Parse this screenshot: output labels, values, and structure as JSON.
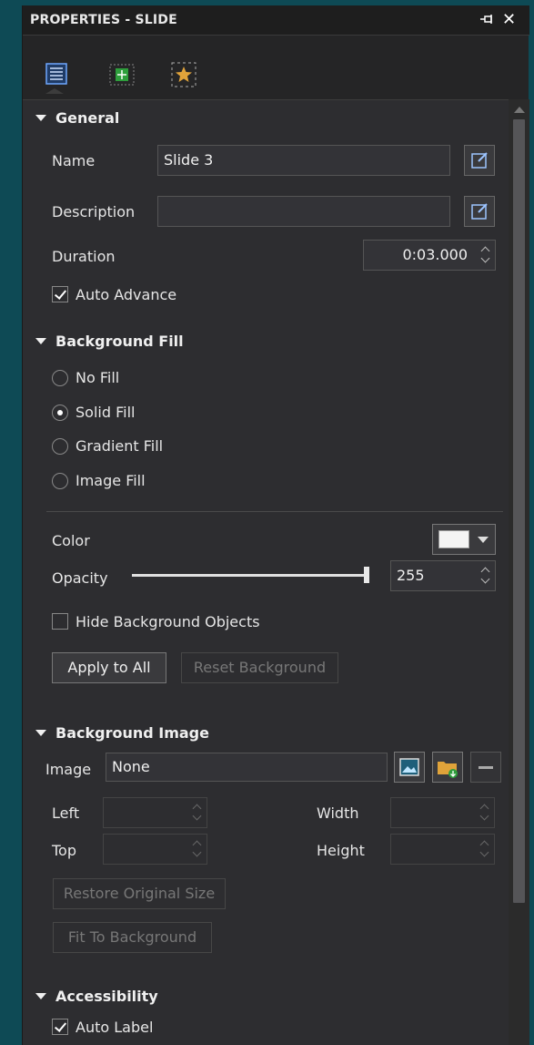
{
  "panel": {
    "title": "PROPERTIES - SLIDE",
    "close_label": "✕"
  },
  "toolbar": {
    "tabs": [
      {
        "name": "properties-tab-icon",
        "active": true
      },
      {
        "name": "transition-tab-icon",
        "active": false
      },
      {
        "name": "effects-tab-icon",
        "active": false
      }
    ]
  },
  "general": {
    "header": "General",
    "name_label": "Name",
    "name_value": "Slide 3",
    "description_label": "Description",
    "description_value": "",
    "duration_label": "Duration",
    "duration_value": "0:03.000",
    "auto_advance_label": "Auto Advance",
    "auto_advance_checked": true
  },
  "background_fill": {
    "header": "Background Fill",
    "options": [
      {
        "label": "No Fill",
        "selected": false
      },
      {
        "label": "Solid Fill",
        "selected": true
      },
      {
        "label": "Gradient Fill",
        "selected": false
      },
      {
        "label": "Image Fill",
        "selected": false
      }
    ],
    "color_label": "Color",
    "color_value": "#f4f4f4",
    "opacity_label": "Opacity",
    "opacity_value": "255",
    "opacity_fraction": 1.0,
    "hide_bg_objects_label": "Hide Background Objects",
    "hide_bg_objects_checked": false,
    "apply_to_all_label": "Apply to All",
    "reset_background_label": "Reset Background"
  },
  "background_image": {
    "header": "Background Image",
    "image_label": "Image",
    "image_value": "None",
    "left_label": "Left",
    "top_label": "Top",
    "width_label": "Width",
    "height_label": "Height",
    "restore_label": "Restore Original Size",
    "fit_label": "Fit To Background"
  },
  "accessibility": {
    "header": "Accessibility",
    "auto_label_label": "Auto Label",
    "auto_label_checked": true
  }
}
